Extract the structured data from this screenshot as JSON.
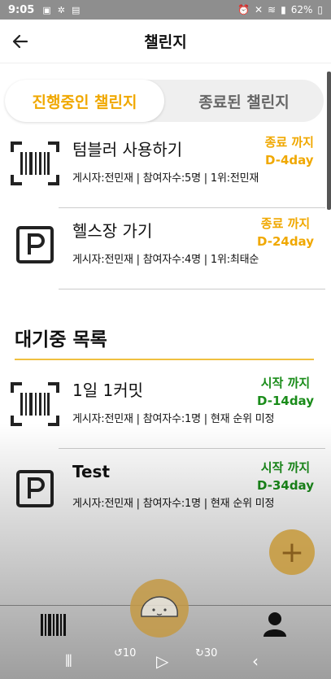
{
  "status_bar": {
    "time": "9:05",
    "battery": "62%"
  },
  "header": {
    "back_icon": "back-arrow-icon",
    "title": "챌린지"
  },
  "tabs": [
    {
      "label": "진행중인 챌린지",
      "active": true
    },
    {
      "label": "종료된 챌린지",
      "active": false
    }
  ],
  "active_challenges": [
    {
      "icon": "barcode-icon",
      "title": "텀블러 사용하기",
      "meta": "게시자:전민재 | 참여자수:5명 | 1위:전민재",
      "status_label": "종료 까지",
      "status_days": "D-4day"
    },
    {
      "icon": "parking-icon",
      "title": "헬스장 가기",
      "meta": "게시자:전민재 | 참여자수:4명 | 1위:최태순",
      "status_label": "종료 까지",
      "status_days": "D-24day"
    }
  ],
  "waiting_section": {
    "title": "대기중 목록"
  },
  "waiting_challenges": [
    {
      "icon": "barcode-icon",
      "title": "1일 1커밋",
      "meta": "게시자:전민재 | 참여자수:1명 | 현재 순위 미정",
      "status_label": "시작 까지",
      "status_days": "D-14day"
    },
    {
      "icon": "parking-icon",
      "title": "Test",
      "meta": "게시자:전민재 | 참여자수:1명 | 현재 순위 미정",
      "status_label": "시작 까지",
      "status_days": "D-34day"
    }
  ],
  "fab": {
    "label": "+"
  },
  "bottom_nav": {
    "left_icon": "barcode-icon",
    "center_icon": "mascot-icon",
    "right_icon": "profile-icon"
  },
  "system_nav": {
    "rewind_label": "10",
    "forward_label": "30"
  },
  "colors": {
    "accent": "#f0a800",
    "start_green": "#1a8c1a",
    "fab": "#c89a3a"
  }
}
